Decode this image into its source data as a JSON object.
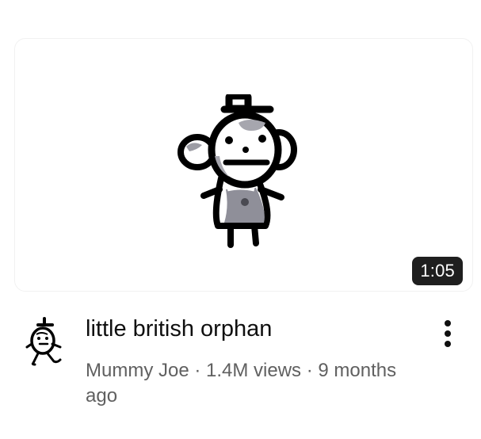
{
  "video": {
    "duration": "1:05",
    "title": "little british orphan",
    "channel": "Mummy Joe",
    "separator": " · ",
    "views": "1.4M views",
    "age": "9 months ago"
  },
  "icons": {
    "thumbnail": "stick-monkey-doodle",
    "avatar": "stick-figure-doodle-icon",
    "menu": "more-vert-icon"
  },
  "colors": {
    "title": "#0f0f0f",
    "meta": "#606060",
    "duration_bg": "#1f1f1f",
    "duration_text": "#ffffff"
  }
}
